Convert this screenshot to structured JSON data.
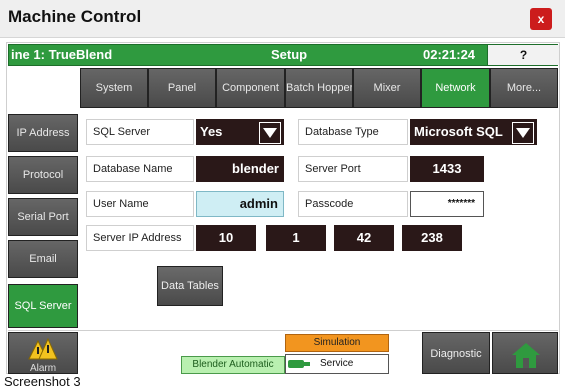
{
  "window": {
    "title": "Machine Control",
    "close_label": "x"
  },
  "header": {
    "line_label": "ine 1: TrueBlend",
    "section": "Setup",
    "time": "02:21:24",
    "help_label": "?"
  },
  "tabs": [
    {
      "label": "System"
    },
    {
      "label": "Panel"
    },
    {
      "label": "Component"
    },
    {
      "label": "Batch Hopper"
    },
    {
      "label": "Mixer"
    },
    {
      "label": "Network"
    },
    {
      "label": "More..."
    }
  ],
  "active_tab": "Network",
  "sidebar": [
    {
      "label": "IP Address"
    },
    {
      "label": "Protocol"
    },
    {
      "label": "Serial Port"
    },
    {
      "label": "Email"
    },
    {
      "label": "SQL Server"
    }
  ],
  "active_sidebar": "SQL Server",
  "form": {
    "sql_server": {
      "label": "SQL Server",
      "value": "Yes"
    },
    "database_type": {
      "label": "Database Type",
      "value": "Microsoft SQL"
    },
    "database_name": {
      "label": "Database Name",
      "value": "blender"
    },
    "server_port": {
      "label": "Server Port",
      "value": "1433"
    },
    "user_name": {
      "label": "User Name",
      "value": "admin"
    },
    "passcode": {
      "label": "Passcode",
      "value": "*******"
    },
    "server_ip": {
      "label": "Server IP Address",
      "octets": [
        "10",
        "1",
        "42",
        "238"
      ]
    }
  },
  "data_tables_label": "Data Tables",
  "bottom": {
    "alarm_label": "Alarm",
    "blender_status": "Blender Automatic",
    "simulation_label": "Simulation",
    "service_label": "Service",
    "diagnostic_label": "Diagnostic"
  },
  "caption": "Screenshot 3",
  "colors": {
    "accent_green": "#2f9a3f",
    "button_gray": "#555555",
    "value_bg": "#2a1818",
    "simulation_orange": "#f2951f",
    "close_red": "#cc1c1c",
    "blender_green": "#b9f0b0"
  },
  "icons": {
    "alarm": "warning-triangles-icon",
    "home": "home-icon",
    "dropdown": "dropdown-arrow-icon",
    "service": "service-wrench-icon",
    "close": "close-icon"
  }
}
